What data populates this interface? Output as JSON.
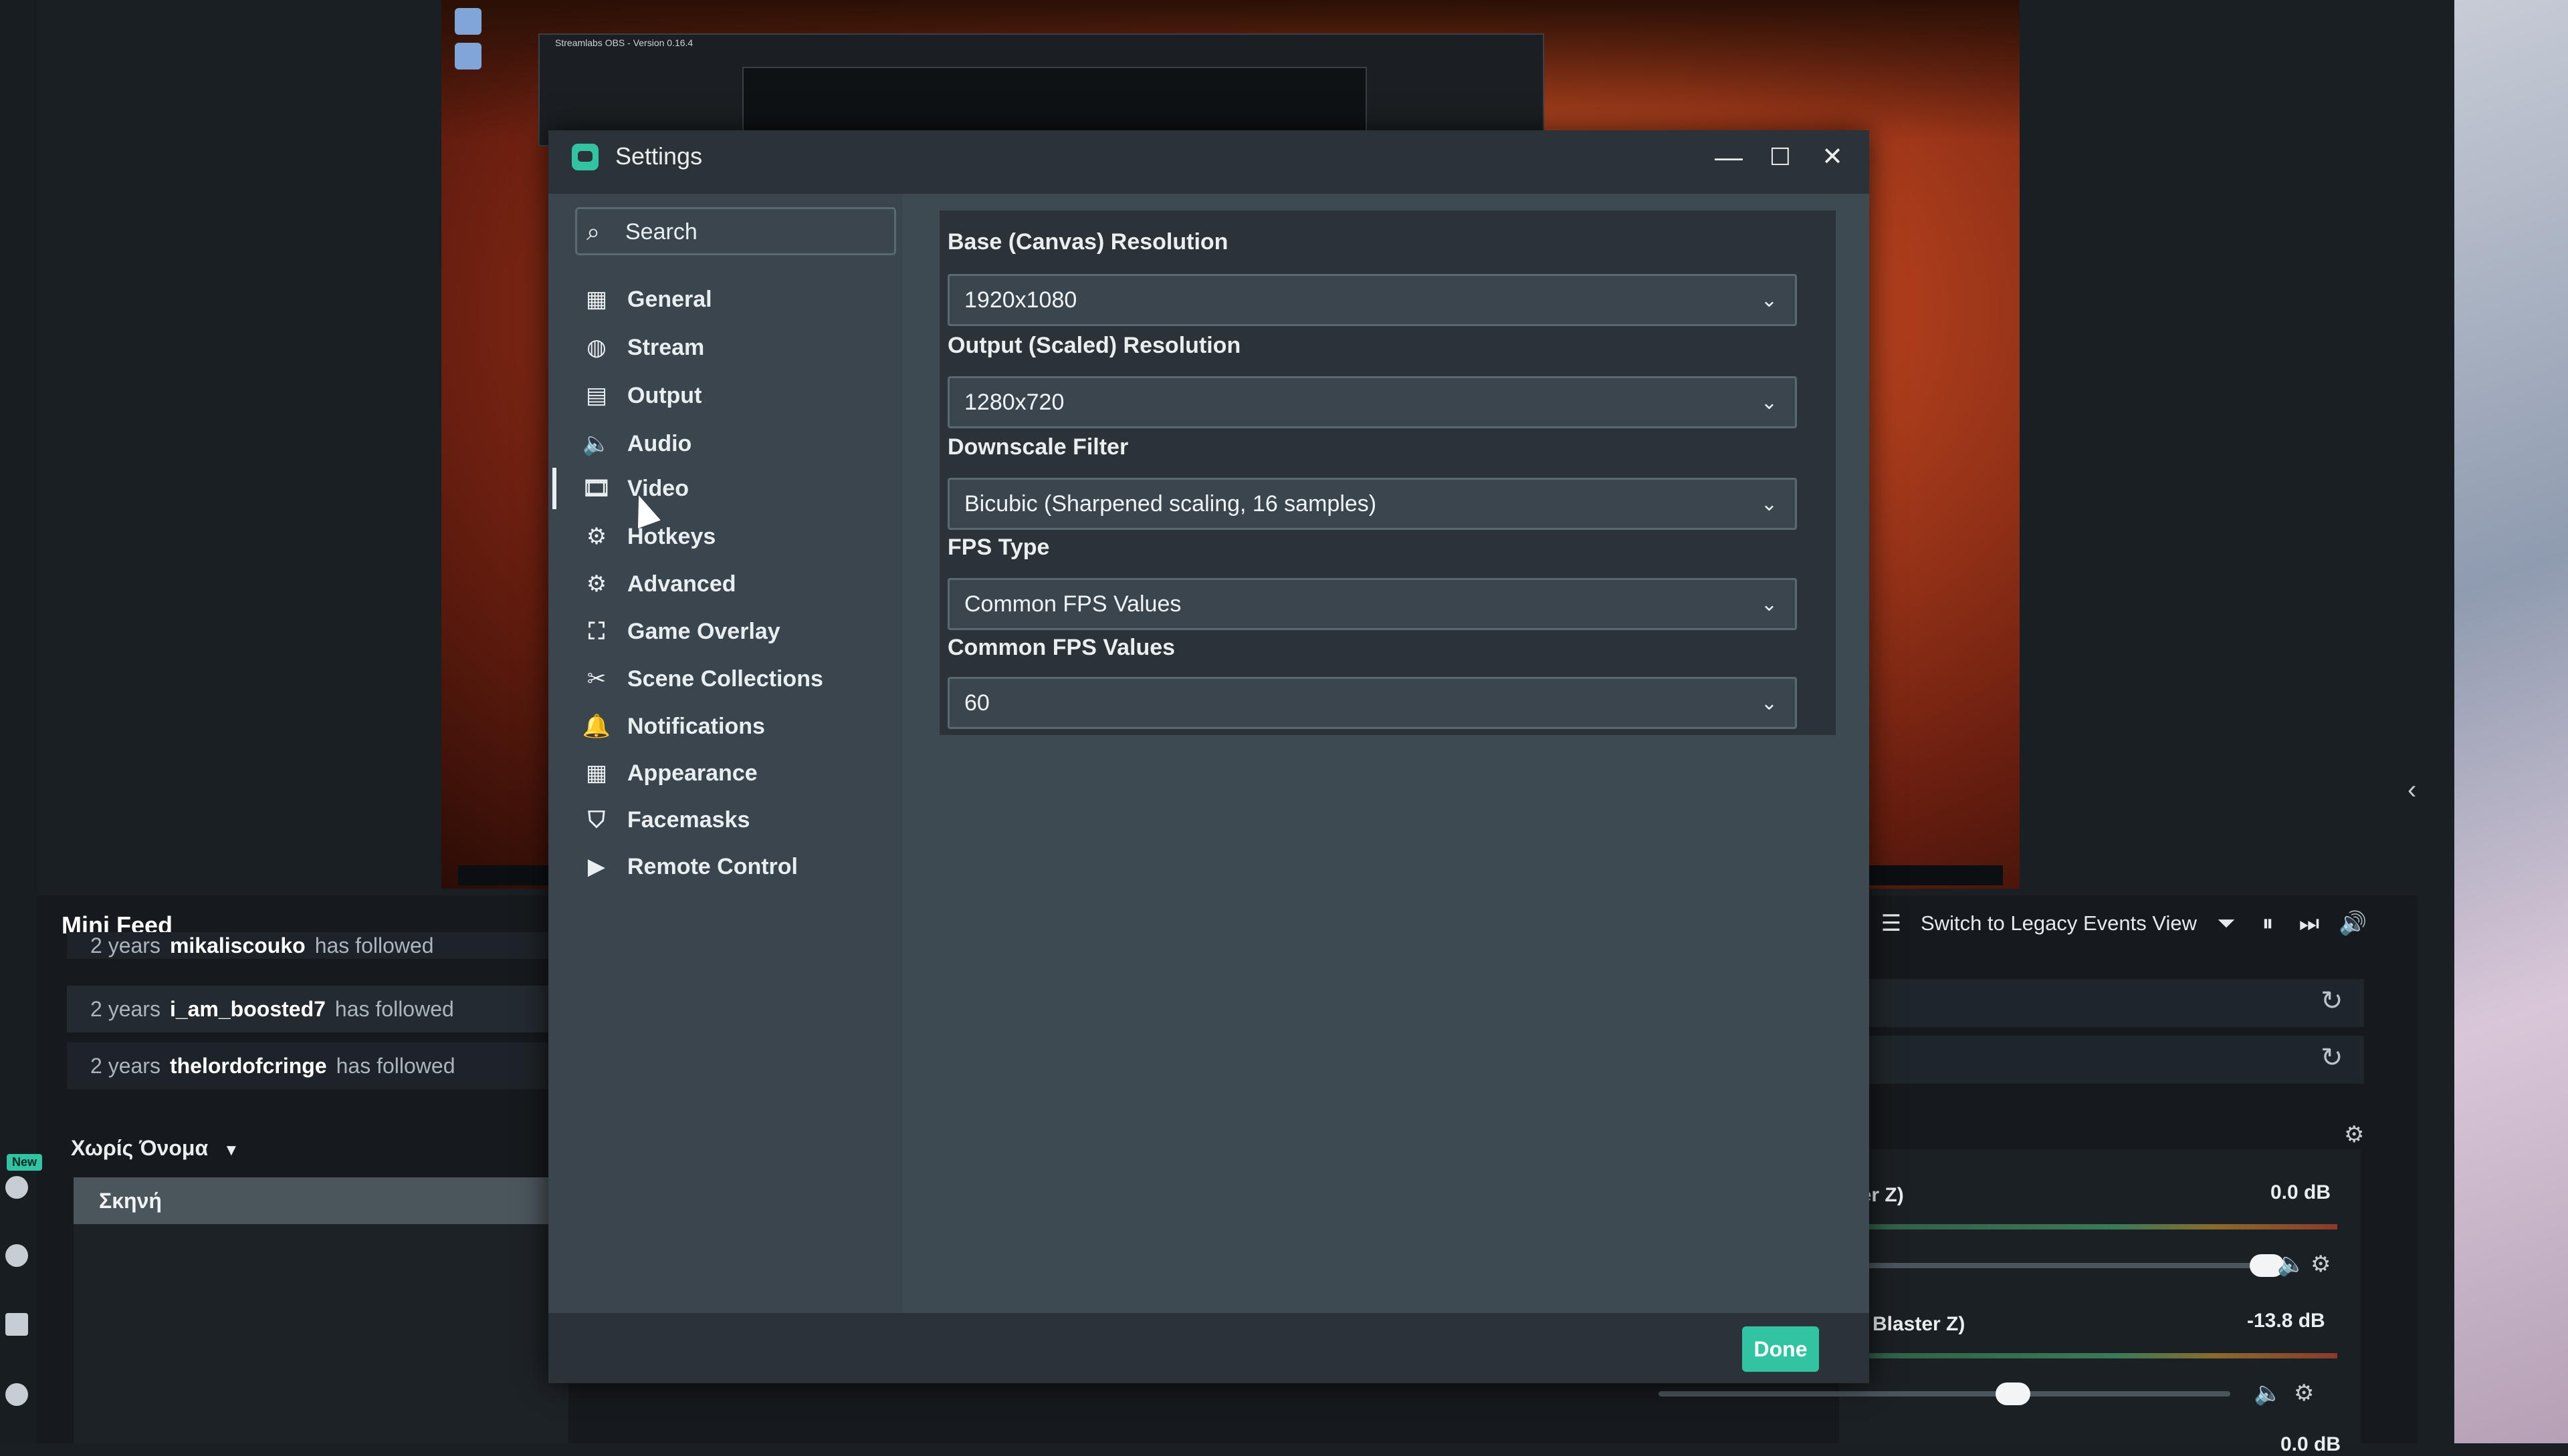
{
  "nested_obs": {
    "title": "Streamlabs OBS - Version 0.16.4",
    "inner_title": "Settings"
  },
  "settings": {
    "title": "Settings",
    "search_placeholder": "Search",
    "nav": [
      {
        "label": "General",
        "icon": "grid-icon"
      },
      {
        "label": "Stream",
        "icon": "globe-icon"
      },
      {
        "label": "Output",
        "icon": "chip-icon"
      },
      {
        "label": "Audio",
        "icon": "speaker-icon"
      },
      {
        "label": "Video",
        "icon": "film-icon",
        "active": true
      },
      {
        "label": "Hotkeys",
        "icon": "gear-icon"
      },
      {
        "label": "Advanced",
        "icon": "gears-icon"
      },
      {
        "label": "Game Overlay",
        "icon": "expand-icon"
      },
      {
        "label": "Scene Collections",
        "icon": "tools-icon"
      },
      {
        "label": "Notifications",
        "icon": "bell-icon"
      },
      {
        "label": "Appearance",
        "icon": "grid-icon"
      },
      {
        "label": "Facemasks",
        "icon": "mask-icon"
      },
      {
        "label": "Remote Control",
        "icon": "play-icon"
      }
    ],
    "fields": [
      {
        "label": "Base (Canvas) Resolution",
        "value": "1920x1080"
      },
      {
        "label": "Output (Scaled) Resolution",
        "value": "1280x720"
      },
      {
        "label": "Downscale Filter",
        "value": "Bicubic (Sharpened scaling, 16 samples)"
      },
      {
        "label": "FPS Type",
        "value": "Common FPS Values"
      },
      {
        "label": "Common FPS Values",
        "value": "60"
      }
    ],
    "done_label": "Done",
    "window_buttons": {
      "minimize": "—",
      "maximize": "☐",
      "close": "✕"
    }
  },
  "mini_feed": {
    "title": "Mini Feed",
    "rows": [
      {
        "age": "2 years",
        "user": "mikaliscouko",
        "action": "has followed"
      },
      {
        "age": "2 years",
        "user": "i_am_boosted7",
        "action": "has followed"
      },
      {
        "age": "2 years",
        "user": "thelordofcringe",
        "action": "has followed"
      }
    ],
    "legacy_label": "Switch to Legacy Events View"
  },
  "scenes": {
    "collection_name": "Χωρίς Όνομα",
    "items": [
      "Σκηνή"
    ]
  },
  "mixer": [
    {
      "name": "ster Z)",
      "db": "0.0 dB",
      "level": 1.0
    },
    {
      "name": "nd Blaster Z)",
      "db": "-13.8 dB",
      "level": 0.62
    },
    {
      "name": "",
      "db": "0.0 dB",
      "level": 1.0
    }
  ],
  "badges": {
    "new": "New"
  },
  "colors": {
    "accent": "#31c3a2",
    "panel": "#3e4a52",
    "titlebar": "#2b3338"
  }
}
